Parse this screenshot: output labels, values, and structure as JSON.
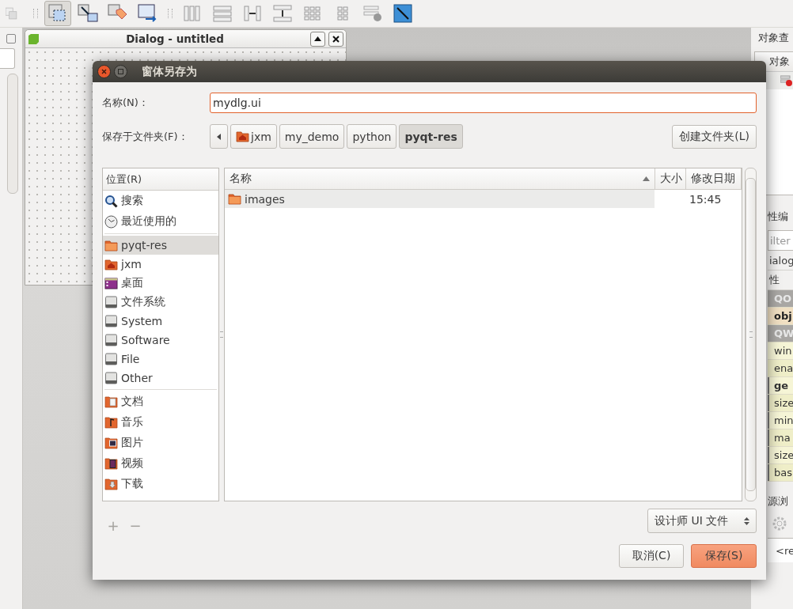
{
  "toolbar": {
    "tools": [
      {
        "kind": "cut",
        "selected": false
      },
      {
        "kind": "edit-widgets",
        "selected": true
      },
      {
        "kind": "signals",
        "selected": false
      },
      {
        "kind": "buddies",
        "selected": false
      },
      {
        "kind": "tab-order",
        "selected": false
      },
      {
        "kind": "h-layout",
        "selected": false
      },
      {
        "kind": "v-layout",
        "selected": false
      },
      {
        "kind": "h-splitter",
        "selected": false
      },
      {
        "kind": "v-splitter",
        "selected": false
      },
      {
        "kind": "grid",
        "selected": false
      },
      {
        "kind": "form",
        "selected": false
      },
      {
        "kind": "break-layout",
        "selected": false
      },
      {
        "kind": "adjust-size",
        "selected": false
      }
    ]
  },
  "form_window": {
    "title": "Dialog - untitled"
  },
  "object_inspector": {
    "title": "对象查",
    "column": "对象"
  },
  "property_editor": {
    "title": "性编",
    "filter_placeholder": "ilter",
    "object": "ialog",
    "column": "性",
    "rows": [
      {
        "kind": "group",
        "label": "QO"
      },
      {
        "kind": "highlight",
        "label": "obj"
      },
      {
        "kind": "group",
        "label": "QW"
      },
      {
        "kind": "property",
        "label": "win",
        "bold": false,
        "expandable": false
      },
      {
        "kind": "property",
        "label": "ena",
        "bold": false,
        "expandable": false
      },
      {
        "kind": "property",
        "label": "ge",
        "bold": true,
        "expandable": true
      },
      {
        "kind": "property",
        "label": "size",
        "bold": false,
        "expandable": true
      },
      {
        "kind": "property",
        "label": "min",
        "bold": false,
        "expandable": true
      },
      {
        "kind": "property",
        "label": "ma",
        "bold": false,
        "expandable": true
      },
      {
        "kind": "property",
        "label": "size",
        "bold": false,
        "expandable": true
      },
      {
        "kind": "property",
        "label": "bas",
        "bold": false,
        "expandable": true
      }
    ]
  },
  "resource_browser": {
    "title": "源浏",
    "item": "<re"
  },
  "dialog": {
    "title": "窗体另存为",
    "name_label": "名称(N)：",
    "name_value": "mydlg.ui",
    "folder_label": "保存于文件夹(F)：",
    "path": [
      {
        "kind": "home",
        "label": "jxm",
        "selected": false
      },
      {
        "kind": "folder",
        "label": "my_demo",
        "selected": false
      },
      {
        "kind": "folder",
        "label": "python",
        "selected": false
      },
      {
        "kind": "folder",
        "label": "pyqt-res",
        "selected": true
      }
    ],
    "new_folder": "创建文件夹(L)",
    "places": {
      "header": "位置(R)",
      "groups": [
        [
          {
            "kind": "search",
            "label": "搜索",
            "selected": false
          },
          {
            "kind": "recent",
            "label": "最近使用的",
            "selected": false
          }
        ],
        [
          {
            "kind": "folder",
            "label": "pyqt-res",
            "selected": true
          },
          {
            "kind": "home",
            "label": "jxm",
            "selected": false
          },
          {
            "kind": "desktop",
            "label": "桌面",
            "selected": false
          },
          {
            "kind": "drive",
            "label": "文件系统",
            "selected": false
          },
          {
            "kind": "drive",
            "label": "System",
            "selected": false
          },
          {
            "kind": "drive",
            "label": "Software",
            "selected": false
          },
          {
            "kind": "drive",
            "label": "File",
            "selected": false
          },
          {
            "kind": "drive",
            "label": "Other",
            "selected": false
          }
        ],
        [
          {
            "kind": "documents",
            "label": "文档",
            "selected": false
          },
          {
            "kind": "music",
            "label": "音乐",
            "selected": false
          },
          {
            "kind": "pictures",
            "label": "图片",
            "selected": false
          },
          {
            "kind": "videos",
            "label": "视频",
            "selected": false
          },
          {
            "kind": "downloads",
            "label": "下载",
            "selected": false
          }
        ]
      ]
    },
    "place_buttons": [
      {
        "label": "+",
        "disabled": true
      },
      {
        "label": "−",
        "disabled": true
      }
    ],
    "files": {
      "columns": [
        {
          "label": "名称",
          "sorted": true
        },
        {
          "label": "大小",
          "sorted": false
        },
        {
          "label": "修改日期",
          "sorted": false
        }
      ],
      "rows": [
        {
          "name": "images",
          "modified": "15:45"
        }
      ]
    },
    "filter": "设计师 UI 文件",
    "cancel": "取消(C)",
    "save": "保存(S)"
  }
}
